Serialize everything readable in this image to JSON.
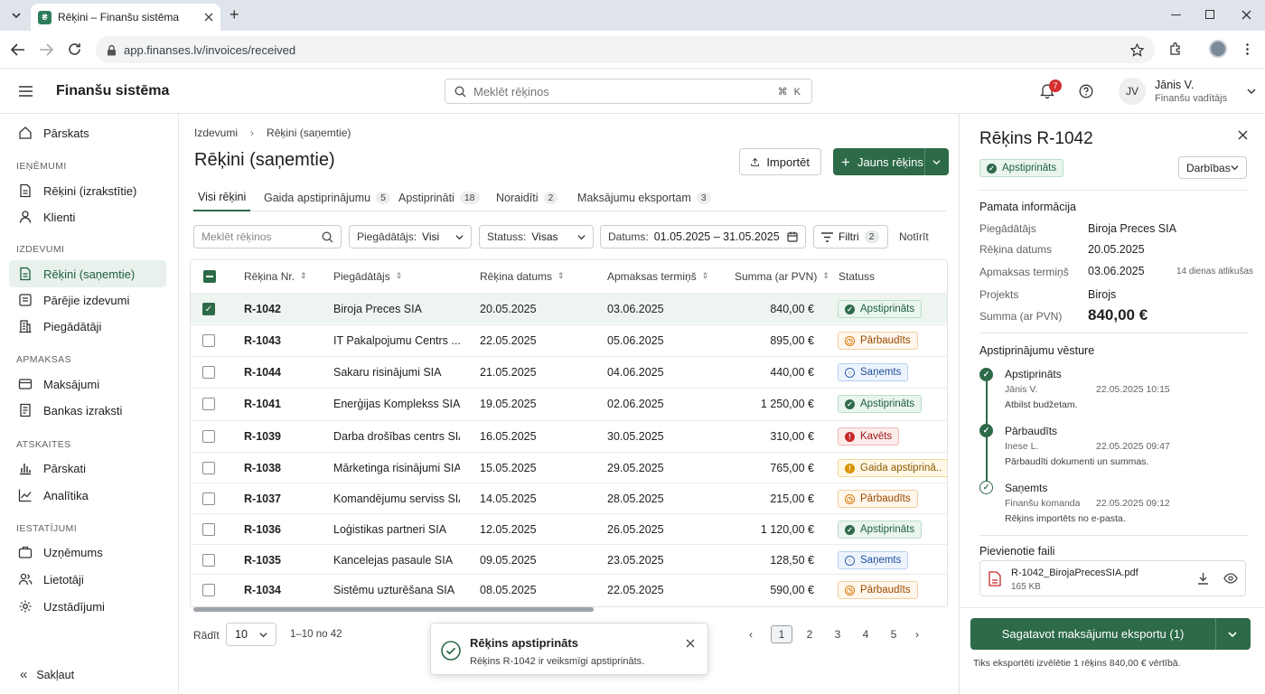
{
  "browser": {
    "tab_title": "Rēķini – Finanšu sistēma",
    "favicon_letter": "₴",
    "url": "app.finanses.lv/invoices/received"
  },
  "app": {
    "brand": "Finanšu sistēma",
    "search_placeholder": "Meklēt rēķinos",
    "search_shortcut": "⌘ K",
    "notification_count": "7",
    "user_initials": "JV",
    "user_name": "Jānis V.",
    "user_role": "Finanšu vadītājs"
  },
  "sidebar": {
    "overview": "Pārskats",
    "sections": {
      "income": "IEŅĒMUMI",
      "expenses": "IZDEVUMI",
      "payments": "APMAKSAS",
      "reports": "ATSKAITES",
      "settings": "IESTATĪJUMI"
    },
    "items": {
      "issued_invoices": "Rēķini (izrakstītie)",
      "clients": "Klienti",
      "received_invoices": "Rēķini (saņemtie)",
      "other_expenses": "Pārējie izdevumi",
      "suppliers": "Piegādātāji",
      "payments": "Maksājumi",
      "bank_statements": "Bankas izraksti",
      "reports": "Pārskati",
      "analytics": "Analītika",
      "company": "Uzņēmums",
      "users": "Lietotāji",
      "settings": "Uzstādījumi"
    },
    "collapse": "Sakļaut"
  },
  "main": {
    "breadcrumb": [
      "Izdevumi",
      "Rēķini (saņemtie)"
    ],
    "title": "Rēķini (saņemtie)",
    "import_label": "Importēt",
    "new_invoice_label": "Jauns rēķins",
    "tabs": [
      {
        "label": "Visi rēķini",
        "count": ""
      },
      {
        "label": "Gaida apstiprinājumu",
        "count": "5"
      },
      {
        "label": "Apstiprināti",
        "count": "18"
      },
      {
        "label": "Noraidīti",
        "count": "2"
      },
      {
        "label": "Maksājumu eksportam",
        "count": "3"
      }
    ],
    "filters": {
      "search_placeholder": "Meklēt rēķinos",
      "supplier_label": "Piegādātājs:",
      "supplier_value": "Visi",
      "status_label": "Statuss:",
      "status_value": "Visas",
      "date_label": "Datums:",
      "date_value": "01.05.2025 – 31.05.2025",
      "filters_label": "Filtri",
      "filters_count": "2",
      "clear_label": "Notīrīt"
    },
    "columns": [
      "Rēķina Nr.",
      "Piegādātājs",
      "Rēķina datums",
      "Apmaksas termiņš",
      "Summa (ar PVN)",
      "Statuss"
    ],
    "rows": [
      {
        "nr": "R-1042",
        "supplier": "Biroja Preces SIA",
        "date": "20.05.2025",
        "due": "03.06.2025",
        "sum": "840,00 €",
        "status": "Apstiprināts",
        "kind": "apst",
        "checked": true
      },
      {
        "nr": "R-1043",
        "supplier": "IT Pakalpojumu Centrs ...",
        "date": "22.05.2025",
        "due": "05.06.2025",
        "sum": "895,00 €",
        "status": "Pārbaudīts",
        "kind": "parb",
        "checked": false
      },
      {
        "nr": "R-1044",
        "supplier": "Sakaru risinājumi SIA",
        "date": "21.05.2025",
        "due": "04.06.2025",
        "sum": "440,00 €",
        "status": "Saņemts",
        "kind": "san",
        "checked": false
      },
      {
        "nr": "R-1041",
        "supplier": "Enerģijas Komplekss SIA",
        "date": "19.05.2025",
        "due": "02.06.2025",
        "sum": "1 250,00 €",
        "status": "Apstiprināts",
        "kind": "apst",
        "checked": false
      },
      {
        "nr": "R-1039",
        "supplier": "Darba drošības centrs SIA",
        "date": "16.05.2025",
        "due": "30.05.2025",
        "sum": "310,00 €",
        "status": "Kavēts",
        "kind": "kav",
        "checked": false
      },
      {
        "nr": "R-1038",
        "supplier": "Mārketinga risinājumi SIA",
        "date": "15.05.2025",
        "due": "29.05.2025",
        "sum": "765,00 €",
        "status": "Gaida apstiprinā..",
        "kind": "gaida",
        "checked": false
      },
      {
        "nr": "R-1037",
        "supplier": "Komandējumu serviss SIA",
        "date": "14.05.2025",
        "due": "28.05.2025",
        "sum": "215,00 €",
        "status": "Pārbaudīts",
        "kind": "parb",
        "checked": false
      },
      {
        "nr": "R-1036",
        "supplier": "Loģistikas partneri SIA",
        "date": "12.05.2025",
        "due": "26.05.2025",
        "sum": "1 120,00 €",
        "status": "Apstiprināts",
        "kind": "apst",
        "checked": false
      },
      {
        "nr": "R-1035",
        "supplier": "Kancelejas pasaule SIA",
        "date": "09.05.2025",
        "due": "23.05.2025",
        "sum": "128,50 €",
        "status": "Saņemts",
        "kind": "san",
        "checked": false
      },
      {
        "nr": "R-1034",
        "supplier": "Sistēmu uzturēšana SIA",
        "date": "08.05.2025",
        "due": "22.05.2025",
        "sum": "590,00 €",
        "status": "Pārbaudīts",
        "kind": "parb",
        "checked": false
      }
    ],
    "show_label": "Rādīt",
    "page_size": "10",
    "range_text": "1–10 no 42",
    "pages": [
      "1",
      "2",
      "3",
      "4",
      "5"
    ],
    "current_page": "1"
  },
  "toast": {
    "title": "Rēķins apstiprināts",
    "message": "Rēķins R-1042 ir veiksmīgi apstiprināts."
  },
  "panel": {
    "title": "Rēķins R-1042",
    "status": "Apstiprināts",
    "actions_label": "Darbības",
    "basic_info_title": "Pamata informācija",
    "fields": {
      "supplier_label": "Piegādātājs",
      "supplier_value": "Biroja Preces SIA",
      "date_label": "Rēķina datums",
      "date_value": "20.05.2025",
      "due_label": "Apmaksas termiņš",
      "due_value": "03.06.2025",
      "due_note": "14 dienas atlikušas",
      "project_label": "Projekts",
      "project_value": "Birojs",
      "sum_label": "Summa (ar PVN)",
      "sum_value": "840,00 €"
    },
    "history_title": "Apstiprinājumu vēsture",
    "history": [
      {
        "status": "Apstiprināts",
        "who": "Jānis V.",
        "when": "22.05.2025 10:15",
        "note": "Atbilst budžetam."
      },
      {
        "status": "Pārbaudīts",
        "who": "Inese L.",
        "when": "22.05.2025 09:47",
        "note": "Pārbaudīti dokumenti un summas."
      },
      {
        "status": "Saņemts",
        "who": "Finanšu komanda",
        "when": "22.05.2025 09:12",
        "note": "Rēķins importēts no e-pasta."
      }
    ],
    "files_title": "Pievienotie faili",
    "file_name": "R-1042_BirojaPrecesSIA.pdf",
    "file_size": "165 KB",
    "export_label": "Sagatavot maksājumu eksportu (1)",
    "export_note": "Tiks eksportēti izvēlētie 1 rēķins 840,00 € vērtībā."
  }
}
